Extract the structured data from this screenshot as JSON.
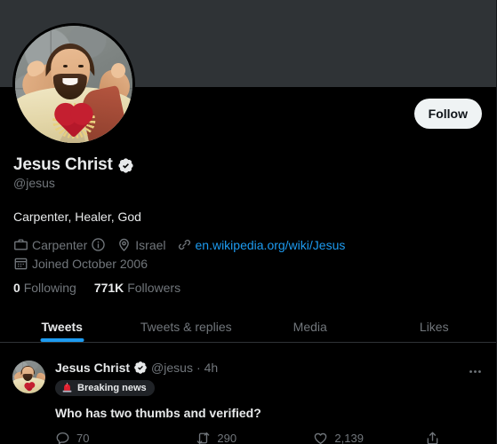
{
  "profile": {
    "banner_color": "#2f3336",
    "avatar_alt": "buddy-christ-statue",
    "display_name": "Jesus Christ",
    "handle": "@jesus",
    "bio": "Carpenter, Healer, God",
    "verified": true,
    "follow_label": "Follow",
    "meta": {
      "profession_icon": "briefcase-icon",
      "profession": "Carpenter",
      "info_icon": "info-circle-icon",
      "location_icon": "location-pin-icon",
      "location": "Israel",
      "link_icon": "link-icon",
      "website": "en.wikipedia.org/wiki/Jesus",
      "joined_icon": "calendar-icon",
      "joined": "Joined October 2006"
    },
    "counts": {
      "following_value": "0",
      "following_label": "Following",
      "followers_value": "771K",
      "followers_label": "Followers"
    }
  },
  "tabs": [
    {
      "label": "Tweets",
      "active": true
    },
    {
      "label": "Tweets & replies",
      "active": false
    },
    {
      "label": "Media",
      "active": false
    },
    {
      "label": "Likes",
      "active": false
    }
  ],
  "tweet": {
    "author_name": "Jesus Christ",
    "author_handle": "@jesus",
    "separator": "·",
    "timestamp": "4h",
    "verified": true,
    "more_icon": "ellipsis-horizontal-icon",
    "category_badge": {
      "icon": "siren-emoji",
      "label": "Breaking news"
    },
    "text": "Who has two thumbs and verified?",
    "actions": [
      {
        "icon": "reply-icon",
        "count": "70"
      },
      {
        "icon": "retweet-icon",
        "count": "290"
      },
      {
        "icon": "heart-icon",
        "count": "2,139"
      },
      {
        "icon": "share-icon",
        "count": ""
      }
    ]
  },
  "colors": {
    "accent": "#1d9bf0",
    "background": "#000000",
    "text_primary": "#e7e9ea",
    "text_secondary": "#71767b",
    "border": "#2f3336"
  }
}
